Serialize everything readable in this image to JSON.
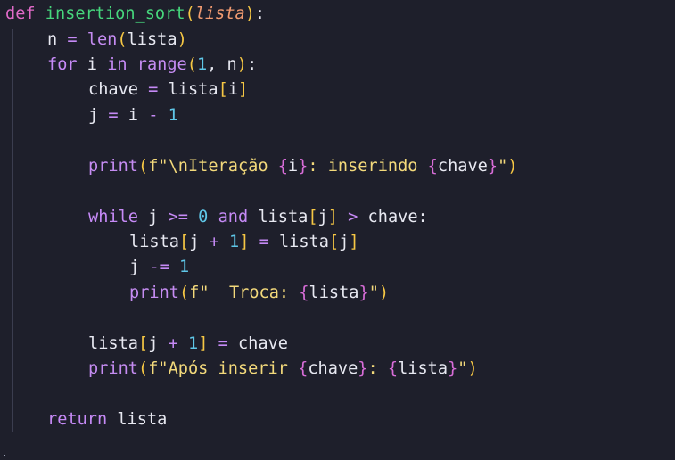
{
  "code": {
    "l1": {
      "def": "def",
      "name": "insertion_sort",
      "open": "(",
      "param": "lista",
      "close": ")",
      "colon": ":"
    },
    "l2": {
      "a": "n",
      "eq": " = ",
      "fn": "len",
      "open": "(",
      "arg": "lista",
      "close": ")"
    },
    "l3": {
      "kw_for": "for",
      "var": " i ",
      "kw_in": "in",
      "sp": " ",
      "fn": "range",
      "open": "(",
      "num": "1",
      "sep": ", n",
      "close": ")",
      "colon": ":"
    },
    "l4": {
      "a": "chave",
      "eq": " = ",
      "b": "lista",
      "open": "[",
      "idx": "i",
      "close": "]"
    },
    "l5": {
      "a": "j",
      "eq": " = ",
      "b": "i ",
      "op": "-",
      "sp": " ",
      "num": "1"
    },
    "l6": {
      "fn": "print",
      "open": "(",
      "pre": "f\"",
      "esc": "\\n",
      "s1": "Iteração ",
      "b1o": "{",
      "v1": "i",
      "b1c": "}",
      "s2": ": inserindo ",
      "b2o": "{",
      "v2": "chave",
      "b2c": "}",
      "end": "\"",
      "close": ")"
    },
    "l7": {
      "kw_while": "while",
      "a": " j ",
      "op1": ">=",
      "sp1": " ",
      "num": "0",
      "sp2": " ",
      "kw_and": "and",
      "b": " lista",
      "open": "[",
      "idx": "j",
      "close": "]",
      "sp3": " ",
      "op2": ">",
      "c": " chave:"
    },
    "l8": {
      "a": "lista",
      "open": "[",
      "idx": "j ",
      "op": "+",
      "sp": " ",
      "num": "1",
      "close": "]",
      "eq": " = ",
      "b": "lista",
      "open2": "[",
      "idx2": "j",
      "close2": "]"
    },
    "l9": {
      "a": "j ",
      "op": "-=",
      "sp": " ",
      "num": "1"
    },
    "l10": {
      "fn": "print",
      "open": "(",
      "pre": "f\"  Troca: ",
      "bo": "{",
      "v": "lista",
      "bc": "}",
      "end": "\"",
      "close": ")"
    },
    "l11": {
      "a": "lista",
      "open": "[",
      "idx": "j ",
      "op": "+",
      "sp": " ",
      "num": "1",
      "close": "]",
      "eq": " = ",
      "b": "chave"
    },
    "l12": {
      "fn": "print",
      "open": "(",
      "pre": "f\"Após inserir ",
      "b1o": "{",
      "v1": "chave",
      "b1c": "}",
      "mid": ": ",
      "b2o": "{",
      "v2": "lista",
      "b2c": "}",
      "end": "\"",
      "close": ")"
    },
    "l13": {
      "kw_return": "return",
      "a": " lista"
    }
  },
  "colors": {
    "background": "#1e1f2b",
    "keyword": "#c68af6",
    "def_keyword": "#e06ac8",
    "function_name": "#46d67c",
    "parameter": "#f29b71",
    "number": "#5fc7e8",
    "string": "#f3d97b",
    "bracket_level1": "#f6c744",
    "bracket_level2": "#d86dd8"
  }
}
